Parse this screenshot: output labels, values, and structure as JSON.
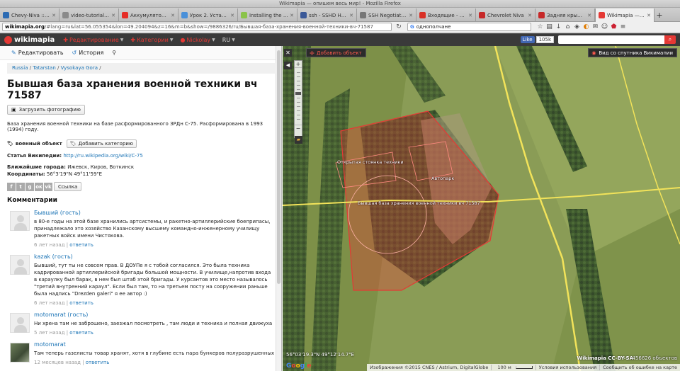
{
  "browser": {
    "window_title": "Wikimapia — опишем весь мир! - Mozilla Firefox",
    "tabs": [
      {
        "label": "Chevy-Niva :: П...",
        "icon": "chevy-niva-favicon",
        "color": "#2c6bb3"
      },
      {
        "label": "video-tutorials-2...",
        "icon": "document-favicon",
        "color": "#8a8a8a"
      },
      {
        "label": "Аккумулятор Di...",
        "icon": "youtube-favicon",
        "color": "#e52d27"
      },
      {
        "label": "Урок 2. Установ...",
        "icon": "globe-favicon",
        "color": "#4a90d9"
      },
      {
        "label": "Installing the An...",
        "icon": "android-favicon",
        "color": "#8bc34a"
      },
      {
        "label": "ssh - SSHD HM...",
        "icon": "stackexchange-favicon",
        "color": "#3b5998"
      },
      {
        "label": "SSH Negotiation ...",
        "icon": "forum-favicon",
        "color": "#777777"
      },
      {
        "label": "Входящие - nic...",
        "icon": "gmail-favicon",
        "color": "#d93025"
      },
      {
        "label": "Chevrolet Niva",
        "icon": "drive2-favicon",
        "color": "#c62828"
      },
      {
        "label": "Задняя крышка ...",
        "icon": "drive2-favicon",
        "color": "#c62828"
      },
      {
        "label": "Wikimapia — on...",
        "icon": "wikimapia-favicon",
        "color": "#e53935",
        "active": true
      }
    ],
    "url_host": "wikimapia.org",
    "url_rest": "/#lang=ru&lat=56.055354&lon=49.204094&z=16&m=b&show=/9886326/ru/Бывшая-база-хранения-военной-техники-вч-71587",
    "search_value": "однополчане"
  },
  "wm": {
    "logo": "wikimapia",
    "menu": {
      "edit": "Редактирование",
      "categories": "Категории",
      "user": "Nickolay",
      "lang": "RU"
    },
    "fb_like": "Like",
    "fb_count": "105k"
  },
  "panel": {
    "tools": {
      "edit": "Редактировать",
      "history": "История"
    },
    "breadcrumb": [
      "Russia",
      "Tatarstan",
      "Vysokaya Gora"
    ],
    "title": "Бывшая база хранения военной техники вч 71587",
    "upload_label": "Загрузить фотографию",
    "description": "База хранения военной техники на базе расформированного ЗРДн С-75. Расформирована в 1993 (1994) году.",
    "tag": "военный объект",
    "add_category": "Добавить категорию",
    "wiki_label": "Статья Википедии:",
    "wiki_link": "http://ru.wikipedia.org/wiki/С-75",
    "nearby_label": "Ближайшие города:",
    "nearby_value": "Ижевск,  Киров,  Воткинск",
    "coords_label": "Координаты:",
    "coords_value": "56°3'19\"N 49°11'59\"E",
    "share_link": "Ссылка",
    "comments_header": "Комментарии",
    "comments": [
      {
        "author": "Бывший (гость)",
        "text": "в 80-е годы на этой базе хранились артсистемы, и ракетно-артиллерийские боеприпасы, принадлежало это хозяйство Казанскому высшему командно-инженерному училищу ракетных войск имени Чистякова.",
        "time": "6 лет назад",
        "reply": "ответить",
        "photo": false
      },
      {
        "author": "kazak (гость)",
        "text": "Бывший, тут ты не совсем прав. В ДОУПе я с тобой согласился. Это была техника кадрированной артиллерийской бригады большой мощности. В училище,напротив входа в караулку был барак, в нем был штаб этой бригады. У курсантов это место называлось \"третий внутренний караул\". Если был там, то на третьем посту на сооружении раньше была надпись \"Drezden galeri\" я ее автор :)",
        "time": "6 лет назад",
        "reply": "ответить",
        "photo": false
      },
      {
        "author": "motomarat (гость)",
        "text": "Ни хрена там не заброшено, заезжал посмотреть , там люди и техника и полная движуха",
        "time": "5 лет назад",
        "reply": "ответить",
        "photo": false
      },
      {
        "author": "motomarat",
        "text": "Там теперь газелисты товар хранят, хотя в глубине есть пара бункеров полуразрушенных",
        "time": "12 месяцев назад",
        "reply": "ответить",
        "photo": true
      }
    ]
  },
  "map": {
    "add_object": "Добавить объект",
    "satellite_btn": "Вид со спутника Викимапии",
    "labels": {
      "parking": "Открытая стоянка техники",
      "autopark": "Автопарк",
      "base": "Бывшая база хранения военной техники вч 71587"
    },
    "coords": "56°03'19.3\"N 49°12'14.7\"E",
    "attribution_brand": "Wikimapia CC-BY-SA",
    "attribution_count": "456626 объектов",
    "google": "Google",
    "footer": {
      "imagery": "Изображения ©2015 CNES / Astrium, DigitalGlobe",
      "scale": "100 м",
      "terms": "Условия использования",
      "report": "Сообщить об ошибке на карте"
    },
    "colors": {
      "polygon": "#e53935",
      "road": "#f2e35a"
    }
  }
}
